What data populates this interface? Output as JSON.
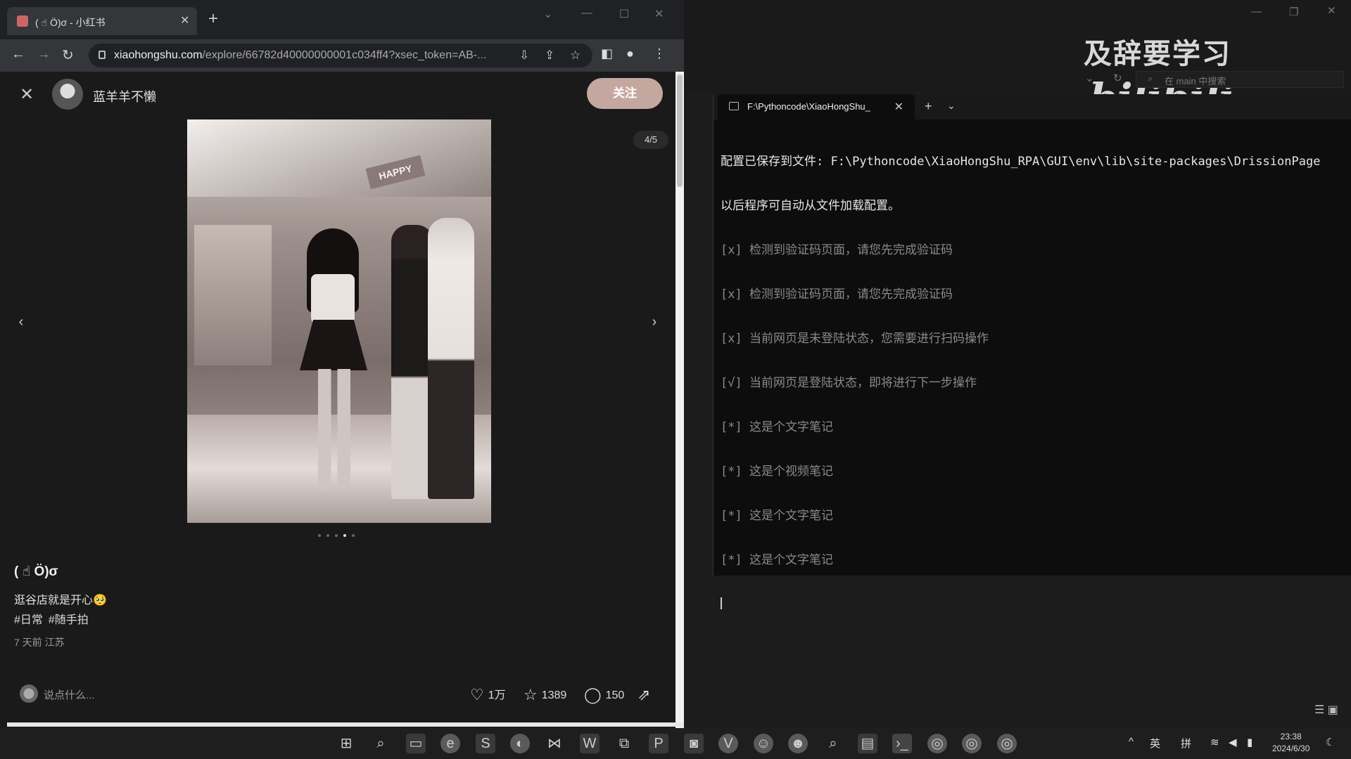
{
  "browser": {
    "tab_title": "( ☝ Ö)σ - 小红书",
    "url_host": "xiaohongshu.com",
    "url_path": "/explore/66782d40000000001c034ff4?xsec_token=AB-..."
  },
  "post": {
    "author": "蓝羊羊不懒",
    "follow_label": "关注",
    "image_counter": "4/5",
    "image_sign": "HAPPY",
    "title": "( ☝ Ö)σ",
    "description": "逛谷店就是开心🥺",
    "tags": [
      "#日常",
      "#随手拍"
    ],
    "meta": "7 天前 江苏",
    "comment_placeholder": "说点什么...",
    "likes": "1万",
    "collects": "1389",
    "comments": "150"
  },
  "watermark": {
    "text": "及辞要学习",
    "logo": "bilibili"
  },
  "explorer": {
    "search_placeholder": "在 main 中搜索"
  },
  "terminal": {
    "tab_title": "F:\\Pythoncode\\XiaoHongShu_",
    "lines": [
      "配置已保存到文件: F:\\Pythoncode\\XiaoHongShu_RPA\\GUI\\env\\lib\\site-packages\\DrissionPage",
      "以后程序可自动从文件加载配置。",
      "[x] 检测到验证码页面，请您先完成验证码",
      "[x] 检测到验证码页面，请您先完成验证码",
      "[x] 当前网页是未登陆状态，您需要进行扫码操作",
      "[√] 当前网页是登陆状态，即将进行下一步操作",
      "[*] 这是个文字笔记",
      "[*] 这是个视频笔记",
      "[*] 这是个文字笔记",
      "[*] 这是个文字笔记"
    ]
  },
  "taskbar": {
    "ime_lang": "英",
    "ime_mode": "拼",
    "time": "23:38",
    "date": "2024/6/30"
  },
  "colors": {
    "follow_button": "#c4a8a0",
    "page_bg": "#1a1a1a",
    "terminal_bg": "#0d0d0d"
  }
}
